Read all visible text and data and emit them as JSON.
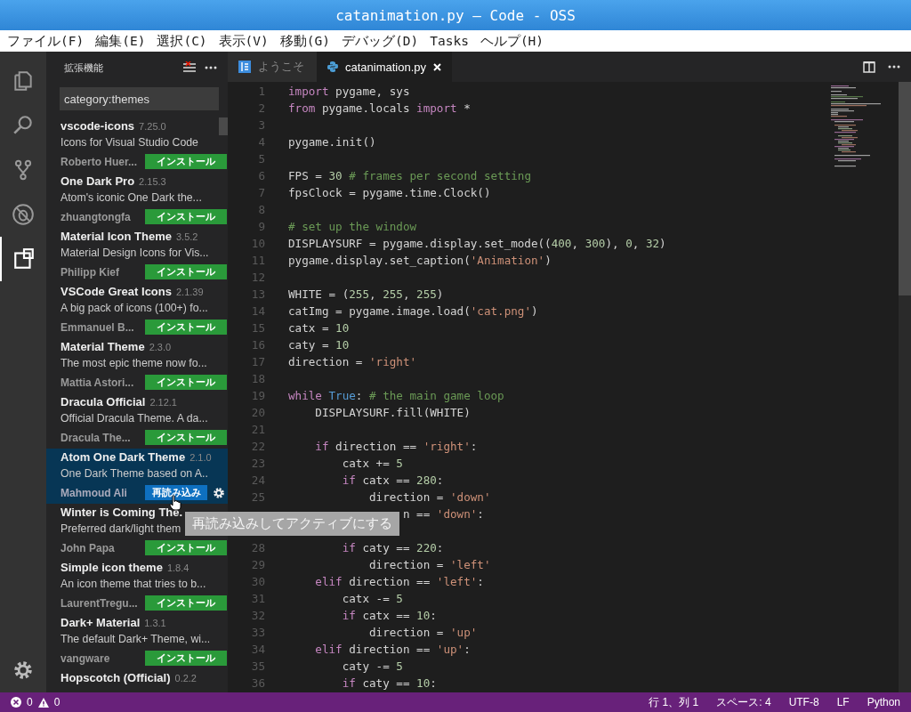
{
  "window": {
    "title": "catanimation.py — Code - OSS"
  },
  "menu": [
    "ファイル(F)",
    "編集(E)",
    "選択(C)",
    "表示(V)",
    "移動(G)",
    "デバッグ(D)",
    "Tasks",
    "ヘルプ(H)"
  ],
  "activity_bar": [
    {
      "kind": "files",
      "selected": false
    },
    {
      "kind": "search",
      "selected": false
    },
    {
      "kind": "git",
      "selected": false
    },
    {
      "kind": "debug",
      "selected": false
    },
    {
      "kind": "extensions",
      "selected": true
    }
  ],
  "sidebar": {
    "title": "拡張機能",
    "search": {
      "value": "category:themes"
    },
    "extensions": [
      {
        "name": "vscode-icons",
        "version": "7.25.0",
        "description": "Icons for Visual Studio Code",
        "author": "Roberto Huer...",
        "action": {
          "kind": "install",
          "label": "インストール"
        },
        "selected": false
      },
      {
        "name": "One Dark Pro",
        "version": "2.15.3",
        "description": "Atom's iconic One Dark the...",
        "author": "zhuangtongfa",
        "action": {
          "kind": "install",
          "label": "インストール"
        },
        "selected": false
      },
      {
        "name": "Material Icon Theme",
        "version": "3.5.2",
        "description": "Material Design Icons for Vis...",
        "author": "Philipp Kief",
        "action": {
          "kind": "install",
          "label": "インストール"
        },
        "selected": false
      },
      {
        "name": "VSCode Great Icons",
        "version": "2.1.39",
        "description": "A big pack of icons (100+) fo...",
        "author": "Emmanuel B...",
        "action": {
          "kind": "install",
          "label": "インストール"
        },
        "selected": false
      },
      {
        "name": "Material Theme",
        "version": "2.3.0",
        "description": "The most epic theme now fo...",
        "author": "Mattia Astori...",
        "action": {
          "kind": "install",
          "label": "インストール"
        },
        "selected": false
      },
      {
        "name": "Dracula Official",
        "version": "2.12.1",
        "description": "Official Dracula Theme. A da...",
        "author": "Dracula The...",
        "action": {
          "kind": "install",
          "label": "インストール"
        },
        "selected": false
      },
      {
        "name": "Atom One Dark Theme",
        "version": "2.1.0",
        "description": "One Dark Theme based on A..",
        "author": "Mahmoud Ali",
        "action": {
          "kind": "reload",
          "label": "再読み込み"
        },
        "selected": true
      },
      {
        "name": "Winter is Coming The.",
        "description": "Preferred dark/light them",
        "author": "John Papa",
        "action": {
          "kind": "install",
          "label": "インストール"
        },
        "selected": false
      },
      {
        "name": "Simple icon theme",
        "version": "1.8.4",
        "description": "An icon theme that tries to b...",
        "author": "LaurentTregu...",
        "action": {
          "kind": "install",
          "label": "インストール"
        },
        "selected": false
      },
      {
        "name": "Dark+ Material",
        "version": "1.3.1",
        "description": "The default Dark+ Theme, wi...",
        "author": "vangware",
        "action": {
          "kind": "install",
          "label": "インストール"
        },
        "selected": false
      },
      {
        "name": "Hopscotch (Official)",
        "version": "0.2.2",
        "selected": false
      }
    ]
  },
  "tabs": [
    {
      "kind": "welcome",
      "label": "ようこそ",
      "selected": false
    },
    {
      "kind": "python",
      "label": "catanimation.py",
      "selected": true
    }
  ],
  "editor": {
    "lines": [
      {
        "kind": "code",
        "number": "1",
        "tokens": [
          {
            "kind": "keyword",
            "text": "import"
          },
          {
            "kind": "plain",
            "text": " pygame, sys"
          }
        ]
      },
      {
        "kind": "code",
        "number": "2",
        "tokens": [
          {
            "kind": "keyword",
            "text": "from"
          },
          {
            "kind": "plain",
            "text": " pygame.locals "
          },
          {
            "kind": "keyword",
            "text": "import"
          },
          {
            "kind": "plain",
            "text": " *"
          }
        ]
      },
      {
        "kind": "code",
        "number": "3"
      },
      {
        "kind": "code",
        "number": "4",
        "tokens": [
          {
            "kind": "plain",
            "text": "pygame.init()"
          }
        ]
      },
      {
        "kind": "code",
        "number": "5"
      },
      {
        "kind": "code",
        "number": "6",
        "tokens": [
          {
            "kind": "plain",
            "text": "FPS = "
          },
          {
            "kind": "number",
            "text": "30"
          },
          {
            "kind": "comment",
            "text": " # frames per second setting"
          }
        ]
      },
      {
        "kind": "code",
        "number": "7",
        "tokens": [
          {
            "kind": "plain",
            "text": "fpsClock = pygame.time.Clock()"
          }
        ]
      },
      {
        "kind": "code",
        "number": "8"
      },
      {
        "kind": "code",
        "number": "9",
        "tokens": [
          {
            "kind": "comment",
            "text": "# set up the window"
          }
        ]
      },
      {
        "kind": "code",
        "number": "10",
        "tokens": [
          {
            "kind": "plain",
            "text": "DISPLAYSURF = pygame.display.set_mode(("
          },
          {
            "kind": "number",
            "text": "400"
          },
          {
            "kind": "plain",
            "text": ", "
          },
          {
            "kind": "number",
            "text": "300"
          },
          {
            "kind": "plain",
            "text": "), "
          },
          {
            "kind": "number",
            "text": "0"
          },
          {
            "kind": "plain",
            "text": ", "
          },
          {
            "kind": "number",
            "text": "32"
          },
          {
            "kind": "plain",
            "text": ")"
          }
        ]
      },
      {
        "kind": "code",
        "number": "11",
        "tokens": [
          {
            "kind": "plain",
            "text": "pygame.display.set_caption("
          },
          {
            "kind": "string",
            "text": "'Animation'"
          },
          {
            "kind": "plain",
            "text": ")"
          }
        ]
      },
      {
        "kind": "code",
        "number": "12"
      },
      {
        "kind": "code",
        "number": "13",
        "tokens": [
          {
            "kind": "plain",
            "text": "WHITE = ("
          },
          {
            "kind": "number",
            "text": "255"
          },
          {
            "kind": "plain",
            "text": ", "
          },
          {
            "kind": "number",
            "text": "255"
          },
          {
            "kind": "plain",
            "text": ", "
          },
          {
            "kind": "number",
            "text": "255"
          },
          {
            "kind": "plain",
            "text": ")"
          }
        ]
      },
      {
        "kind": "code",
        "number": "14",
        "tokens": [
          {
            "kind": "plain",
            "text": "catImg = pygame.image.load("
          },
          {
            "kind": "string",
            "text": "'cat.png'"
          },
          {
            "kind": "plain",
            "text": ")"
          }
        ]
      },
      {
        "kind": "code",
        "number": "15",
        "tokens": [
          {
            "kind": "plain",
            "text": "catx = "
          },
          {
            "kind": "number",
            "text": "10"
          }
        ]
      },
      {
        "kind": "code",
        "number": "16",
        "tokens": [
          {
            "kind": "plain",
            "text": "caty = "
          },
          {
            "kind": "number",
            "text": "10"
          }
        ]
      },
      {
        "kind": "code",
        "number": "17",
        "tokens": [
          {
            "kind": "plain",
            "text": "direction = "
          },
          {
            "kind": "string",
            "text": "'right'"
          }
        ]
      },
      {
        "kind": "code",
        "number": "18"
      },
      {
        "kind": "code",
        "number": "19",
        "tokens": [
          {
            "kind": "keyword",
            "text": "while"
          },
          {
            "kind": "constant",
            "text": " True"
          },
          {
            "kind": "plain",
            "text": ":"
          },
          {
            "kind": "comment",
            "text": " # the main game loop"
          }
        ]
      },
      {
        "kind": "code",
        "number": "20",
        "tokens": [
          {
            "kind": "plain",
            "text": "    DISPLAYSURF.fill(WHITE)"
          }
        ]
      },
      {
        "kind": "code",
        "number": "21"
      },
      {
        "kind": "code",
        "number": "22",
        "tokens": [
          {
            "kind": "keyword",
            "text": "    if"
          },
          {
            "kind": "plain",
            "text": " direction == "
          },
          {
            "kind": "string",
            "text": "'right'"
          },
          {
            "kind": "plain",
            "text": ":"
          }
        ]
      },
      {
        "kind": "code",
        "number": "23",
        "tokens": [
          {
            "kind": "plain",
            "text": "        catx += "
          },
          {
            "kind": "number",
            "text": "5"
          }
        ]
      },
      {
        "kind": "code",
        "number": "24",
        "tokens": [
          {
            "kind": "keyword",
            "text": "        if"
          },
          {
            "kind": "plain",
            "text": " catx == "
          },
          {
            "kind": "number",
            "text": "280"
          },
          {
            "kind": "plain",
            "text": ":"
          }
        ]
      },
      {
        "kind": "code",
        "number": "25",
        "tokens": [
          {
            "kind": "plain",
            "text": "            direction = "
          },
          {
            "kind": "string",
            "text": "'down'"
          }
        ]
      },
      {
        "kind": "covered",
        "tokens": [
          {
            "kind": "plain",
            "text": "                 n == "
          },
          {
            "kind": "string",
            "text": "'down'"
          },
          {
            "kind": "plain",
            "text": ":"
          }
        ]
      },
      {
        "kind": "covered"
      },
      {
        "kind": "code",
        "number": "28",
        "tokens": [
          {
            "kind": "keyword",
            "text": "        if"
          },
          {
            "kind": "plain",
            "text": " caty == "
          },
          {
            "kind": "number",
            "text": "220"
          },
          {
            "kind": "plain",
            "text": ":"
          }
        ]
      },
      {
        "kind": "code",
        "number": "29",
        "tokens": [
          {
            "kind": "plain",
            "text": "            direction = "
          },
          {
            "kind": "string",
            "text": "'left'"
          }
        ]
      },
      {
        "kind": "code",
        "number": "30",
        "tokens": [
          {
            "kind": "keyword",
            "text": "    elif"
          },
          {
            "kind": "plain",
            "text": " direction == "
          },
          {
            "kind": "string",
            "text": "'left'"
          },
          {
            "kind": "plain",
            "text": ":"
          }
        ]
      },
      {
        "kind": "code",
        "number": "31",
        "tokens": [
          {
            "kind": "plain",
            "text": "        catx -= "
          },
          {
            "kind": "number",
            "text": "5"
          }
        ]
      },
      {
        "kind": "code",
        "number": "32",
        "tokens": [
          {
            "kind": "keyword",
            "text": "        if"
          },
          {
            "kind": "plain",
            "text": " catx == "
          },
          {
            "kind": "number",
            "text": "10"
          },
          {
            "kind": "plain",
            "text": ":"
          }
        ]
      },
      {
        "kind": "code",
        "number": "33",
        "tokens": [
          {
            "kind": "plain",
            "text": "            direction = "
          },
          {
            "kind": "string",
            "text": "'up'"
          }
        ]
      },
      {
        "kind": "code",
        "number": "34",
        "tokens": [
          {
            "kind": "keyword",
            "text": "    elif"
          },
          {
            "kind": "plain",
            "text": " direction == "
          },
          {
            "kind": "string",
            "text": "'up'"
          },
          {
            "kind": "plain",
            "text": ":"
          }
        ]
      },
      {
        "kind": "code",
        "number": "35",
        "tokens": [
          {
            "kind": "plain",
            "text": "        caty -= "
          },
          {
            "kind": "number",
            "text": "5"
          }
        ]
      },
      {
        "kind": "code",
        "number": "36",
        "tokens": [
          {
            "kind": "keyword",
            "text": "        if"
          },
          {
            "kind": "plain",
            "text": " caty == "
          },
          {
            "kind": "number",
            "text": "10"
          },
          {
            "kind": "plain",
            "text": ":"
          }
        ]
      }
    ]
  },
  "tooltip": "再読み込みしてアクティブにする",
  "status_bar": {
    "errors": "0",
    "warnings": "0",
    "items": [
      "行 1、列 1",
      "スペース: 4",
      "UTF-8",
      "LF",
      "Python"
    ]
  }
}
